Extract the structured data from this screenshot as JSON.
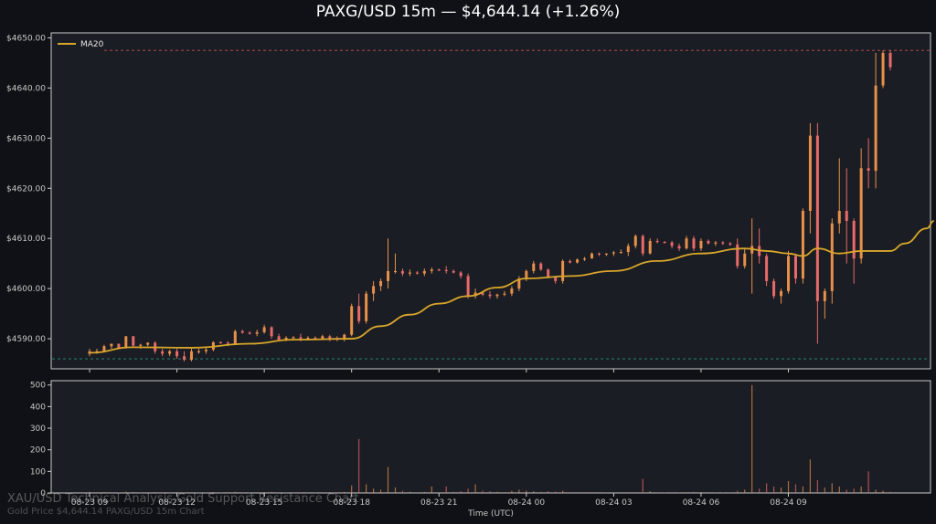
{
  "title": "PAXG/USD 15m — $4,644.14 (+1.26%)",
  "watermark": {
    "line1": "XAU/USD Technical Analysis Gold Support Resistance Chart",
    "line2": "Gold Price $4,644.14 PAXG/USD 15m Chart"
  },
  "colors": {
    "background": "#0f1116",
    "panel": "#1a1d23",
    "up": "#e8904a",
    "down": "#e86a6a",
    "ma": "#d9a62a",
    "resistance": "#e05c5c",
    "support": "#2aa88a"
  },
  "chart_data": {
    "type": "candlestick",
    "title": "PAXG/USD 15m — $4,644.14 (+1.26%)",
    "xlabel": "Time (UTC)",
    "ylim": [
      4584,
      4651
    ],
    "volume_ylim": [
      0,
      520
    ],
    "yticks": [
      "$4590.00",
      "$4600.00",
      "$4610.00",
      "$4620.00",
      "$4630.00",
      "$4640.00",
      "$4650.00"
    ],
    "ytick_values": [
      4590,
      4600,
      4610,
      4620,
      4630,
      4640,
      4650
    ],
    "volume_ticks": [
      "0",
      "100",
      "200",
      "300",
      "400",
      "500"
    ],
    "volume_tick_values": [
      0,
      100,
      200,
      300,
      400,
      500
    ],
    "xticks": [
      {
        "label": "08-23 09",
        "index": 0
      },
      {
        "label": "08-23 12",
        "index": 12
      },
      {
        "label": "08-23 15",
        "index": 24
      },
      {
        "label": "08-23 18",
        "index": 36
      },
      {
        "label": "08-23 21",
        "index": 48
      },
      {
        "label": "08-24 00",
        "index": 60
      },
      {
        "label": "08-24 03",
        "index": 72
      },
      {
        "label": "08-24 06",
        "index": 84
      },
      {
        "label": "08-24 09",
        "index": 96
      }
    ],
    "resistance": 4647.5,
    "support": 4586.0,
    "legend": [
      "MA20"
    ],
    "candles": [
      {
        "o": 4587.0,
        "h": 4588.0,
        "l": 4586.5,
        "c": 4587.5,
        "v": 5
      },
      {
        "o": 4587.5,
        "h": 4588.0,
        "l": 4587.0,
        "c": 4587.5,
        "v": 3
      },
      {
        "o": 4587.5,
        "h": 4588.8,
        "l": 4587.5,
        "c": 4588.5,
        "v": 4
      },
      {
        "o": 4588.5,
        "h": 4589.0,
        "l": 4588.0,
        "c": 4589.0,
        "v": 3
      },
      {
        "o": 4589.0,
        "h": 4589.0,
        "l": 4588.0,
        "c": 4588.2,
        "v": 2
      },
      {
        "o": 4588.2,
        "h": 4590.5,
        "l": 4588.0,
        "c": 4590.5,
        "v": 6
      },
      {
        "o": 4590.5,
        "h": 4590.5,
        "l": 4588.5,
        "c": 4588.6,
        "v": 5
      },
      {
        "o": 4588.6,
        "h": 4589.0,
        "l": 4588.0,
        "c": 4588.8,
        "v": 2
      },
      {
        "o": 4588.8,
        "h": 4589.3,
        "l": 4588.5,
        "c": 4589.2,
        "v": 3
      },
      {
        "o": 4589.2,
        "h": 4589.5,
        "l": 4587.0,
        "c": 4587.5,
        "v": 4
      },
      {
        "o": 4587.5,
        "h": 4588.0,
        "l": 4586.5,
        "c": 4587.0,
        "v": 3
      },
      {
        "o": 4587.0,
        "h": 4587.8,
        "l": 4586.5,
        "c": 4587.5,
        "v": 2
      },
      {
        "o": 4587.5,
        "h": 4588.0,
        "l": 4586.0,
        "c": 4586.5,
        "v": 4
      },
      {
        "o": 4586.5,
        "h": 4587.5,
        "l": 4585.5,
        "c": 4585.8,
        "v": 3
      },
      {
        "o": 4585.8,
        "h": 4588.0,
        "l": 4585.5,
        "c": 4587.5,
        "v": 3
      },
      {
        "o": 4587.5,
        "h": 4588.0,
        "l": 4587.0,
        "c": 4587.5,
        "v": 2
      },
      {
        "o": 4587.5,
        "h": 4588.2,
        "l": 4587.0,
        "c": 4587.8,
        "v": 2
      },
      {
        "o": 4587.8,
        "h": 4589.5,
        "l": 4587.5,
        "c": 4589.3,
        "v": 4
      },
      {
        "o": 4589.3,
        "h": 4589.5,
        "l": 4589.0,
        "c": 4589.2,
        "v": 2
      },
      {
        "o": 4589.2,
        "h": 4589.5,
        "l": 4588.5,
        "c": 4589.0,
        "v": 3
      },
      {
        "o": 4589.0,
        "h": 4591.8,
        "l": 4589.0,
        "c": 4591.5,
        "v": 5
      },
      {
        "o": 4591.5,
        "h": 4591.8,
        "l": 4591.0,
        "c": 4591.2,
        "v": 3
      },
      {
        "o": 4591.2,
        "h": 4591.5,
        "l": 4590.8,
        "c": 4591.0,
        "v": 2
      },
      {
        "o": 4591.0,
        "h": 4591.8,
        "l": 4590.5,
        "c": 4591.3,
        "v": 3
      },
      {
        "o": 4591.3,
        "h": 4592.8,
        "l": 4591.0,
        "c": 4592.3,
        "v": 4
      },
      {
        "o": 4592.3,
        "h": 4592.5,
        "l": 4590.0,
        "c": 4590.5,
        "v": 5
      },
      {
        "o": 4590.5,
        "h": 4591.0,
        "l": 4589.5,
        "c": 4589.8,
        "v": 3
      },
      {
        "o": 4589.8,
        "h": 4590.5,
        "l": 4589.5,
        "c": 4590.2,
        "v": 2
      },
      {
        "o": 4590.2,
        "h": 4590.5,
        "l": 4590.0,
        "c": 4590.3,
        "v": 1
      },
      {
        "o": 4590.3,
        "h": 4591.0,
        "l": 4589.5,
        "c": 4590.0,
        "v": 3
      },
      {
        "o": 4590.0,
        "h": 4590.5,
        "l": 4589.7,
        "c": 4590.2,
        "v": 2
      },
      {
        "o": 4590.2,
        "h": 4590.5,
        "l": 4589.8,
        "c": 4590.0,
        "v": 2
      },
      {
        "o": 4590.0,
        "h": 4590.8,
        "l": 4589.8,
        "c": 4590.5,
        "v": 3
      },
      {
        "o": 4590.5,
        "h": 4590.8,
        "l": 4589.5,
        "c": 4590.0,
        "v": 4
      },
      {
        "o": 4590.0,
        "h": 4590.5,
        "l": 4589.5,
        "c": 4589.8,
        "v": 3
      },
      {
        "o": 4589.8,
        "h": 4591.0,
        "l": 4589.5,
        "c": 4590.8,
        "v": 5
      },
      {
        "o": 4590.8,
        "h": 4597.0,
        "l": 4590.5,
        "c": 4596.5,
        "v": 35
      },
      {
        "o": 4596.5,
        "h": 4599.0,
        "l": 4593.0,
        "c": 4593.5,
        "v": 250
      },
      {
        "o": 4593.5,
        "h": 4599.5,
        "l": 4593.0,
        "c": 4599.0,
        "v": 40
      },
      {
        "o": 4599.0,
        "h": 4601.5,
        "l": 4597.5,
        "c": 4600.5,
        "v": 20
      },
      {
        "o": 4600.5,
        "h": 4602.0,
        "l": 4599.5,
        "c": 4601.5,
        "v": 15
      },
      {
        "o": 4601.5,
        "h": 4610.0,
        "l": 4600.0,
        "c": 4603.5,
        "v": 120
      },
      {
        "o": 4603.5,
        "h": 4607.0,
        "l": 4603.0,
        "c": 4603.5,
        "v": 25
      },
      {
        "o": 4603.5,
        "h": 4604.0,
        "l": 4602.5,
        "c": 4603.0,
        "v": 10
      },
      {
        "o": 4603.0,
        "h": 4603.8,
        "l": 4602.5,
        "c": 4603.2,
        "v": 5
      },
      {
        "o": 4603.2,
        "h": 4603.5,
        "l": 4602.8,
        "c": 4603.0,
        "v": 3
      },
      {
        "o": 4603.0,
        "h": 4604.0,
        "l": 4602.5,
        "c": 4603.5,
        "v": 5
      },
      {
        "o": 4603.5,
        "h": 4604.2,
        "l": 4603.0,
        "c": 4603.8,
        "v": 30
      },
      {
        "o": 4603.8,
        "h": 4604.0,
        "l": 4603.5,
        "c": 4603.7,
        "v": 3
      },
      {
        "o": 4603.7,
        "h": 4604.5,
        "l": 4603.0,
        "c": 4603.5,
        "v": 30
      },
      {
        "o": 4603.5,
        "h": 4603.8,
        "l": 4603.0,
        "c": 4603.2,
        "v": 5
      },
      {
        "o": 4603.2,
        "h": 4603.5,
        "l": 4602.0,
        "c": 4602.5,
        "v": 8
      },
      {
        "o": 4602.5,
        "h": 4603.0,
        "l": 4598.0,
        "c": 4598.5,
        "v": 20
      },
      {
        "o": 4598.5,
        "h": 4600.0,
        "l": 4598.0,
        "c": 4599.2,
        "v": 40
      },
      {
        "o": 4599.2,
        "h": 4599.5,
        "l": 4598.5,
        "c": 4598.8,
        "v": 10
      },
      {
        "o": 4598.8,
        "h": 4599.5,
        "l": 4598.0,
        "c": 4598.5,
        "v": 8
      },
      {
        "o": 4598.5,
        "h": 4599.0,
        "l": 4598.0,
        "c": 4598.8,
        "v": 5
      },
      {
        "o": 4598.8,
        "h": 4599.5,
        "l": 4598.5,
        "c": 4599.0,
        "v": 3
      },
      {
        "o": 4599.0,
        "h": 4600.5,
        "l": 4598.5,
        "c": 4600.0,
        "v": 10
      },
      {
        "o": 4600.0,
        "h": 4602.5,
        "l": 4599.5,
        "c": 4602.0,
        "v": 15
      },
      {
        "o": 4602.0,
        "h": 4603.8,
        "l": 4601.5,
        "c": 4603.5,
        "v": 10
      },
      {
        "o": 4603.5,
        "h": 4605.5,
        "l": 4603.0,
        "c": 4605.0,
        "v": 8
      },
      {
        "o": 4605.0,
        "h": 4605.3,
        "l": 4603.5,
        "c": 4603.8,
        "v": 5
      },
      {
        "o": 4603.8,
        "h": 4604.0,
        "l": 4602.0,
        "c": 4602.3,
        "v": 8
      },
      {
        "o": 4602.3,
        "h": 4602.5,
        "l": 4601.0,
        "c": 4601.5,
        "v": 6
      },
      {
        "o": 4601.5,
        "h": 4605.8,
        "l": 4601.0,
        "c": 4605.5,
        "v": 10
      },
      {
        "o": 4605.5,
        "h": 4605.8,
        "l": 4605.0,
        "c": 4605.2,
        "v": 3
      },
      {
        "o": 4605.2,
        "h": 4606.0,
        "l": 4605.0,
        "c": 4605.8,
        "v": 3
      },
      {
        "o": 4605.8,
        "h": 4606.3,
        "l": 4605.5,
        "c": 4606.0,
        "v": 3
      },
      {
        "o": 4606.0,
        "h": 4607.2,
        "l": 4606.0,
        "c": 4607.0,
        "v": 3
      },
      {
        "o": 4607.0,
        "h": 4607.2,
        "l": 4606.5,
        "c": 4606.8,
        "v": 3
      },
      {
        "o": 4606.8,
        "h": 4607.0,
        "l": 4606.5,
        "c": 4607.0,
        "v": 2
      },
      {
        "o": 4607.0,
        "h": 4607.5,
        "l": 4606.5,
        "c": 4607.2,
        "v": 2
      },
      {
        "o": 4607.2,
        "h": 4607.8,
        "l": 4607.0,
        "c": 4607.3,
        "v": 3
      },
      {
        "o": 4607.3,
        "h": 4609.0,
        "l": 4606.5,
        "c": 4608.5,
        "v": 3
      },
      {
        "o": 4608.5,
        "h": 4610.8,
        "l": 4608.0,
        "c": 4610.5,
        "v": 3
      },
      {
        "o": 4610.5,
        "h": 4610.8,
        "l": 4606.5,
        "c": 4607.0,
        "v": 65
      },
      {
        "o": 4607.0,
        "h": 4610.0,
        "l": 4606.8,
        "c": 4609.5,
        "v": 8
      },
      {
        "o": 4609.5,
        "h": 4610.0,
        "l": 4609.0,
        "c": 4609.3,
        "v": 3
      },
      {
        "o": 4609.3,
        "h": 4609.5,
        "l": 4609.0,
        "c": 4609.2,
        "v": 2
      },
      {
        "o": 4609.2,
        "h": 4609.5,
        "l": 4608.0,
        "c": 4608.5,
        "v": 3
      },
      {
        "o": 4608.5,
        "h": 4609.0,
        "l": 4607.5,
        "c": 4608.0,
        "v": 2
      },
      {
        "o": 4608.0,
        "h": 4610.5,
        "l": 4607.8,
        "c": 4610.0,
        "v": 3
      },
      {
        "o": 4610.0,
        "h": 4610.5,
        "l": 4607.5,
        "c": 4608.0,
        "v": 5
      },
      {
        "o": 4608.0,
        "h": 4610.0,
        "l": 4607.5,
        "c": 4609.5,
        "v": 4
      },
      {
        "o": 4609.5,
        "h": 4609.8,
        "l": 4608.8,
        "c": 4609.0,
        "v": 3
      },
      {
        "o": 4609.0,
        "h": 4609.5,
        "l": 4608.5,
        "c": 4609.2,
        "v": 2
      },
      {
        "o": 4609.2,
        "h": 4609.5,
        "l": 4608.7,
        "c": 4609.0,
        "v": 2
      },
      {
        "o": 4609.0,
        "h": 4609.3,
        "l": 4608.5,
        "c": 4608.8,
        "v": 2
      },
      {
        "o": 4608.8,
        "h": 4610.0,
        "l": 4604.0,
        "c": 4604.5,
        "v": 10
      },
      {
        "o": 4604.5,
        "h": 4608.0,
        "l": 4604.0,
        "c": 4607.0,
        "v": 15
      },
      {
        "o": 4607.0,
        "h": 4614.0,
        "l": 4599.0,
        "c": 4608.5,
        "v": 500
      },
      {
        "o": 4608.5,
        "h": 4612.0,
        "l": 4605.0,
        "c": 4606.5,
        "v": 20
      },
      {
        "o": 4606.5,
        "h": 4607.0,
        "l": 4600.5,
        "c": 4601.5,
        "v": 45
      },
      {
        "o": 4601.5,
        "h": 4602.0,
        "l": 4598.0,
        "c": 4598.5,
        "v": 30
      },
      {
        "o": 4598.5,
        "h": 4600.0,
        "l": 4597.0,
        "c": 4599.5,
        "v": 25
      },
      {
        "o": 4599.5,
        "h": 4607.5,
        "l": 4599.0,
        "c": 4606.5,
        "v": 55
      },
      {
        "o": 4606.5,
        "h": 4607.0,
        "l": 4601.0,
        "c": 4602.0,
        "v": 40
      },
      {
        "o": 4602.0,
        "h": 4616.0,
        "l": 4601.0,
        "c": 4615.5,
        "v": 30
      },
      {
        "o": 4615.5,
        "h": 4633.0,
        "l": 4611.0,
        "c": 4630.5,
        "v": 155
      },
      {
        "o": 4630.5,
        "h": 4633.0,
        "l": 4589.0,
        "c": 4597.5,
        "v": 60
      },
      {
        "o": 4597.5,
        "h": 4600.0,
        "l": 4594.0,
        "c": 4599.5,
        "v": 25
      },
      {
        "o": 4599.5,
        "h": 4614.0,
        "l": 4597.0,
        "c": 4613.0,
        "v": 45
      },
      {
        "o": 4613.0,
        "h": 4626.0,
        "l": 4611.0,
        "c": 4615.5,
        "v": 30
      },
      {
        "o": 4615.5,
        "h": 4624.0,
        "l": 4605.0,
        "c": 4613.5,
        "v": 15
      },
      {
        "o": 4613.5,
        "h": 4614.0,
        "l": 4601.0,
        "c": 4606.0,
        "v": 20
      },
      {
        "o": 4606.0,
        "h": 4628.0,
        "l": 4605.0,
        "c": 4624.0,
        "v": 30
      },
      {
        "o": 4624.0,
        "h": 4630.0,
        "l": 4620.0,
        "c": 4623.5,
        "v": 100
      },
      {
        "o": 4623.5,
        "h": 4647.0,
        "l": 4620.0,
        "c": 4640.5,
        "v": 15
      },
      {
        "o": 4640.5,
        "h": 4647.5,
        "l": 4640.0,
        "c": 4647.0,
        "v": 10
      },
      {
        "o": 4647.0,
        "h": 4647.5,
        "l": 4643.5,
        "c": 4644.14,
        "v": 5
      }
    ],
    "ma20": [
      {
        "i": 0,
        "v": 4587.2
      },
      {
        "i": 6,
        "v": 4588.3
      },
      {
        "i": 14,
        "v": 4588.2
      },
      {
        "i": 22,
        "v": 4589.0
      },
      {
        "i": 28,
        "v": 4589.8
      },
      {
        "i": 36,
        "v": 4590.0
      },
      {
        "i": 40,
        "v": 4592.5
      },
      {
        "i": 44,
        "v": 4594.8
      },
      {
        "i": 48,
        "v": 4597.0
      },
      {
        "i": 52,
        "v": 4598.5
      },
      {
        "i": 56,
        "v": 4600.2
      },
      {
        "i": 60,
        "v": 4602.0
      },
      {
        "i": 66,
        "v": 4602.5
      },
      {
        "i": 72,
        "v": 4603.5
      },
      {
        "i": 78,
        "v": 4605.5
      },
      {
        "i": 84,
        "v": 4607.0
      },
      {
        "i": 90,
        "v": 4608.0
      },
      {
        "i": 93,
        "v": 4607.5
      },
      {
        "i": 96,
        "v": 4607.0
      },
      {
        "i": 98,
        "v": 4606.5
      },
      {
        "i": 100,
        "v": 4608.0
      },
      {
        "i": 103,
        "v": 4607.0
      },
      {
        "i": 106,
        "v": 4607.5
      },
      {
        "i": 110,
        "v": 4607.5
      },
      {
        "i": 112,
        "v": 4609.0
      },
      {
        "i": 115,
        "v": 4612.0
      },
      {
        "i": 116,
        "v": 4613.5
      }
    ]
  }
}
